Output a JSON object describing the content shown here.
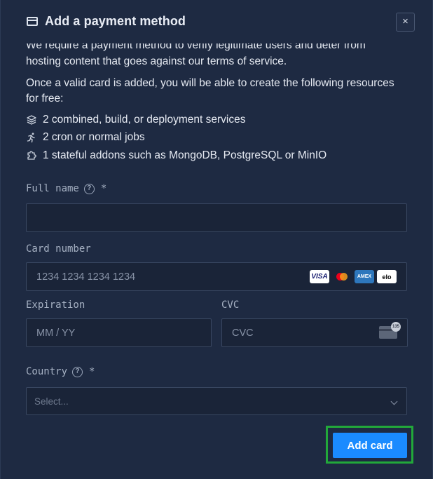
{
  "header": {
    "title": "Add a payment method",
    "close_label": "×"
  },
  "intro": {
    "clipped_line": "We require a payment method to verify legitimate users and deter from",
    "line2": "hosting content that goes against our terms of service.",
    "paragraph2": "Once a valid card is added, you will be able to create the following resources for free:"
  },
  "resources": [
    {
      "icon": "layers-icon",
      "text": "2 combined, build, or deployment services"
    },
    {
      "icon": "runner-icon",
      "text": "2 cron or normal jobs"
    },
    {
      "icon": "puzzle-icon",
      "text": "1 stateful addons such as MongoDB, PostgreSQL or MinIO"
    }
  ],
  "form": {
    "full_name_label": "Full name",
    "full_name_value": "",
    "card_number_label": "Card number",
    "card_number_placeholder": "1234 1234 1234 1234",
    "card_brands": [
      "VISA",
      "mastercard",
      "AMEX",
      "elo"
    ],
    "expiration_label": "Expiration",
    "expiration_placeholder": "MM / YY",
    "cvc_label": "CVC",
    "cvc_placeholder": "CVC",
    "cvc_icon_text": "135",
    "country_label": "Country",
    "country_placeholder": "Select...",
    "required_mark": "*",
    "help_mark": "?"
  },
  "actions": {
    "add_card_label": "Add card"
  },
  "colors": {
    "background": "#1e2a42",
    "input_background": "#1a2438",
    "primary_button": "#1a8bff",
    "highlight_outline": "#22a83a"
  }
}
